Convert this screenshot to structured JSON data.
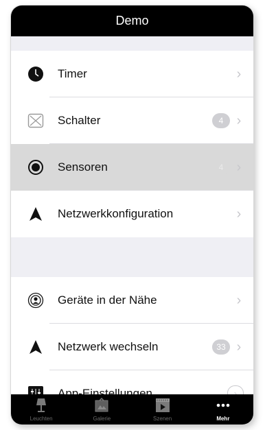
{
  "navbar": {
    "title": "Demo"
  },
  "section1": [
    {
      "label": "Timer",
      "icon": "clock-icon",
      "badge": "",
      "selected": false
    },
    {
      "label": "Schalter",
      "icon": "switch-icon",
      "badge": "4",
      "selected": false
    },
    {
      "label": "Sensoren",
      "icon": "sensor-icon",
      "badge": "4",
      "selected": true
    },
    {
      "label": "Netzwerkkonfiguration",
      "icon": "network-arrow-icon",
      "badge": "",
      "selected": false
    }
  ],
  "section2": [
    {
      "label": "Geräte in der Nähe",
      "icon": "nearby-devices-icon",
      "badge": ""
    },
    {
      "label": "Netzwerk wechseln",
      "icon": "network-arrow-icon",
      "badge": "33"
    },
    {
      "label": "App-Einstellungen",
      "icon": "settings-sliders-icon",
      "badge": ""
    }
  ],
  "tabs": [
    {
      "label": "Leuchten",
      "icon": "lamp-icon",
      "active": false
    },
    {
      "label": "Galerie",
      "icon": "gallery-icon",
      "active": false
    },
    {
      "label": "Szenen",
      "icon": "scenes-icon",
      "active": false
    },
    {
      "label": "Mehr",
      "icon": "more-icon",
      "active": true
    }
  ],
  "colors": {
    "navbar": "#000000",
    "background": "#efeff4",
    "selected_row": "#d9d9d9"
  }
}
